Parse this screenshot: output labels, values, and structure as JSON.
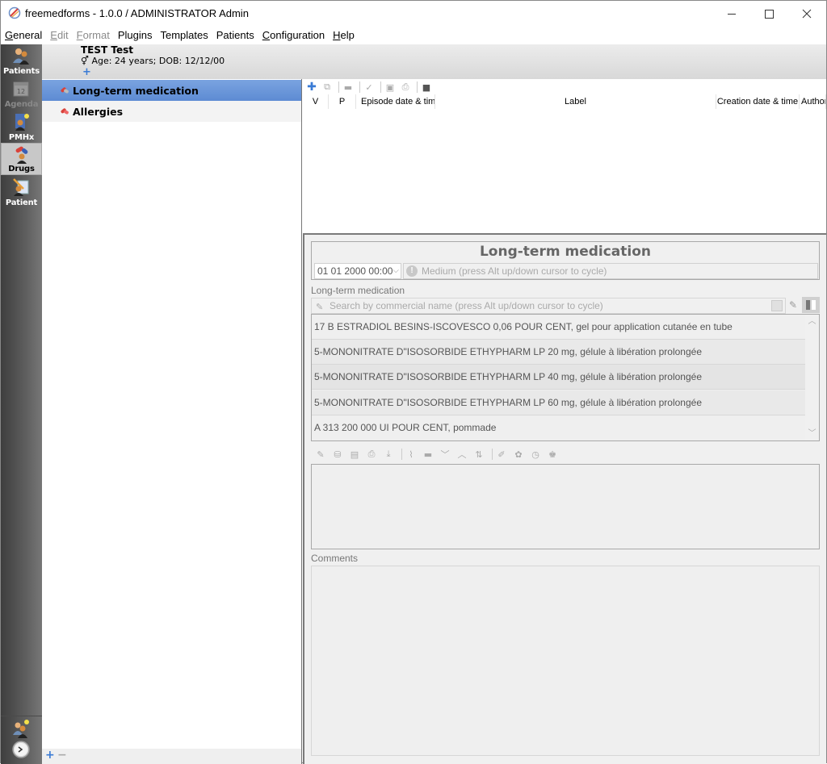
{
  "window": {
    "title": "freemedforms - 1.0.0 /  ADMINISTRATOR Admin",
    "minimize_icon": "minimize-icon",
    "maximize_icon": "maximize-icon",
    "close_icon": "close-icon"
  },
  "menubar": {
    "items": [
      {
        "label": "General",
        "accel": "G",
        "rest": "eneral",
        "disabled": false
      },
      {
        "label": "Edit",
        "accel": "E",
        "rest": "dit",
        "disabled": true
      },
      {
        "label": "Format",
        "accel": "F",
        "rest": "ormat",
        "disabled": true
      },
      {
        "label": "Plugins",
        "accel": "",
        "rest": "Plugins",
        "disabled": false
      },
      {
        "label": "Templates",
        "accel": "",
        "rest": "Templates",
        "disabled": false
      },
      {
        "label": "Patients",
        "accel": "",
        "rest": "Patients",
        "disabled": false
      },
      {
        "label": "Configuration",
        "accel": "C",
        "rest": "onfiguration",
        "disabled": false
      },
      {
        "label": "Help",
        "accel": "H",
        "rest": "elp",
        "disabled": false
      }
    ]
  },
  "modes": [
    {
      "label": "Patients",
      "icon": "patients-icon",
      "state": "normal"
    },
    {
      "label": "Agenda",
      "icon": "calendar-icon",
      "icon_text": "12",
      "state": "disabled"
    },
    {
      "label": "PMHx",
      "icon": "pmhx-icon",
      "state": "normal"
    },
    {
      "label": "Drugs",
      "icon": "drugs-icon",
      "state": "active"
    },
    {
      "label": "Patient",
      "icon": "patient-edit-icon",
      "state": "normal"
    }
  ],
  "sidebar_bottom": {
    "user_icon": "user-icon",
    "clock_icon": "clock-icon"
  },
  "patient": {
    "name": "TEST Test",
    "gender_symbol": "⚥",
    "info": "Age: 24 years; DOB: 12/12/00",
    "add_icon": "+"
  },
  "tree": {
    "items": [
      {
        "label": "Long-term medication",
        "selected": true
      },
      {
        "label": "Allergies",
        "selected": false
      }
    ],
    "footer": {
      "add": "+",
      "remove": "−"
    }
  },
  "episodes": {
    "toolbar": [
      "add-icon",
      "copy-icon",
      "remove-icon",
      "validate-icon",
      "print-icon",
      "print-preview-icon",
      "briefcase-icon"
    ],
    "columns": [
      "V",
      "P",
      "Episode date & time",
      "Label",
      "Creation date & time",
      "Author"
    ]
  },
  "form": {
    "title": "Long-term medication",
    "date": "01 01 2000 00:00",
    "priority": "Medium (press Alt up/down cursor to cycle)",
    "drug_section_label": "Long-term medication",
    "search_placeholder": "Search by commercial name (press Alt up/down cursor to cycle)",
    "drugs": [
      "17 B ESTRADIOL BESINS-ISCOVESCO 0,06 POUR CENT, gel pour application cutanée en tube",
      "5-MONONITRATE D\"ISOSORBIDE ETHYPHARM LP 20 mg, gélule à libération prolongée",
      "5-MONONITRATE D\"ISOSORBIDE ETHYPHARM LP 40 mg, gélule à libération prolongée",
      "5-MONONITRATE D\"ISOSORBIDE ETHYPHARM LP 60 mg, gélule à libération prolongée",
      "A 313 200 000 UI POUR CENT, pommade"
    ],
    "prescription_toolbar": [
      "drug-search-icon",
      "load-icon",
      "book-icon",
      "print-preview-icon",
      "save-icon",
      "clear-icon",
      "remove-icon",
      "move-down-icon",
      "move-up-icon",
      "sort-icon",
      "dosage-icon",
      "interactions-icon",
      "info-icon",
      "patient-icon"
    ],
    "comments_label": "Comments",
    "comments_value": ""
  }
}
